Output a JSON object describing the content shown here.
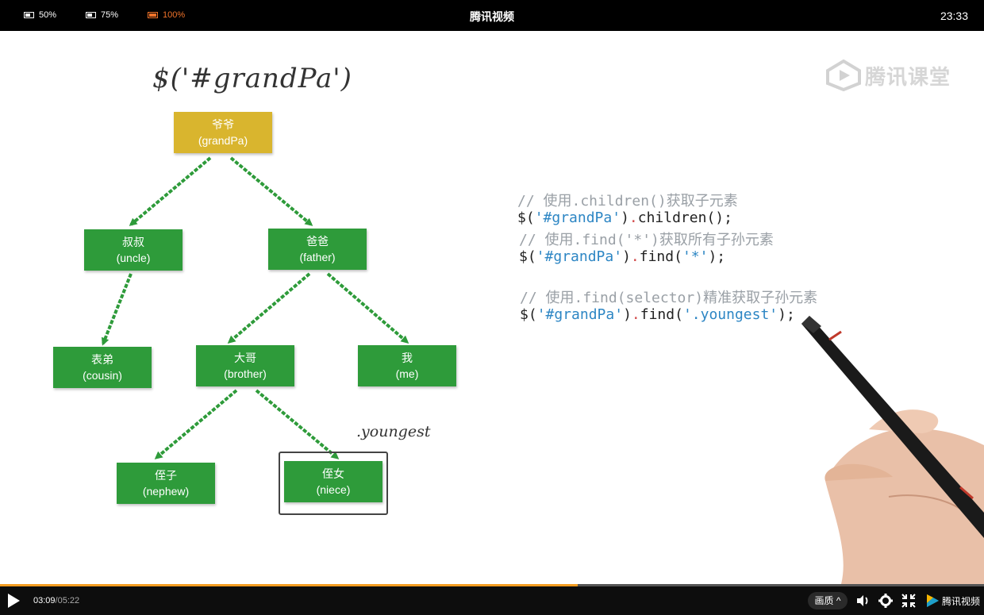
{
  "topbar": {
    "zoom_options": [
      {
        "label": "50%",
        "active": false
      },
      {
        "label": "75%",
        "active": false
      },
      {
        "label": "100%",
        "active": true
      }
    ],
    "title": "腾讯视频",
    "clock": "23:33"
  },
  "watermark": {
    "text": "腾讯课堂"
  },
  "slide": {
    "selector": "$('#grandPa')",
    "nodes": {
      "grandpa": {
        "zh": "爷爷",
        "en": "(grandPa)"
      },
      "uncle": {
        "zh": "叔叔",
        "en": "(uncle)"
      },
      "father": {
        "zh": "爸爸",
        "en": "(father)"
      },
      "cousin": {
        "zh": "表弟",
        "en": "(cousin)"
      },
      "brother": {
        "zh": "大哥",
        "en": "(brother)"
      },
      "me": {
        "zh": "我",
        "en": "(me)"
      },
      "nephew": {
        "zh": "侄子",
        "en": "(nephew)"
      },
      "niece": {
        "zh": "侄女",
        "en": "(niece)"
      }
    },
    "youngest_label": ".youngest",
    "code": {
      "c1": "// 使用.children()获取子元素",
      "l1a": "$(",
      "l1b": "'#grandPa'",
      "l1c": ")",
      "l1d": ".",
      "l1e": "children();",
      "c2": "// 使用.find('*')获取所有子孙元素",
      "l2a": "$(",
      "l2b": "'#grandPa'",
      "l2c": ")",
      "l2d": ".",
      "l2e": "find(",
      "l2f": "'*'",
      "l2g": ");",
      "c3": "// 使用.find(selector)精准获取子孙元素",
      "l3a": "$(",
      "l3b": "'#grandPa'",
      "l3c": ")",
      "l3d": ".",
      "l3e": "find(",
      "l3f": "'.youngest'",
      "l3g": ");"
    }
  },
  "player": {
    "current_time": "03:09",
    "duration": "/05:22",
    "progress": 0.587,
    "quality_label": "画质",
    "brand": "腾讯视频",
    "icons": [
      "play-icon",
      "volume-icon",
      "settings-icon",
      "fullscreen-exit-icon"
    ],
    "colors": {
      "progress": "#f39c21",
      "node_green": "#2e9b3a",
      "node_gold": "#d9b52e",
      "code_string": "#2d86c4",
      "code_dot": "#d24a4a"
    }
  }
}
